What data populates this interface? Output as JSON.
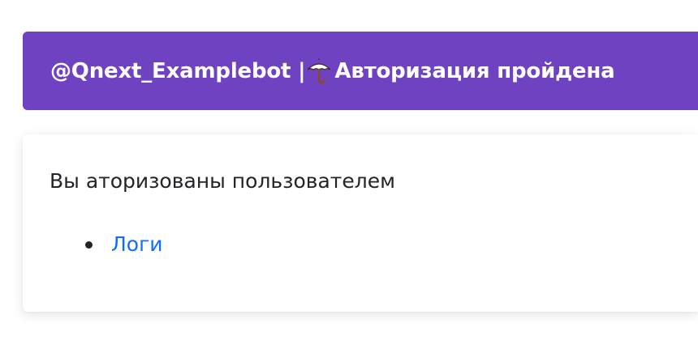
{
  "header": {
    "title_prefix": "@Qnext_Examplebot | ",
    "title_icon": "umbrella-icon",
    "title_suffix": "Авторизация пройдена",
    "background": "#6f42c1"
  },
  "body": {
    "message": "Вы аторизованы пользователем",
    "links": [
      {
        "label": "Логи"
      }
    ],
    "link_color": "#0d6efd"
  }
}
